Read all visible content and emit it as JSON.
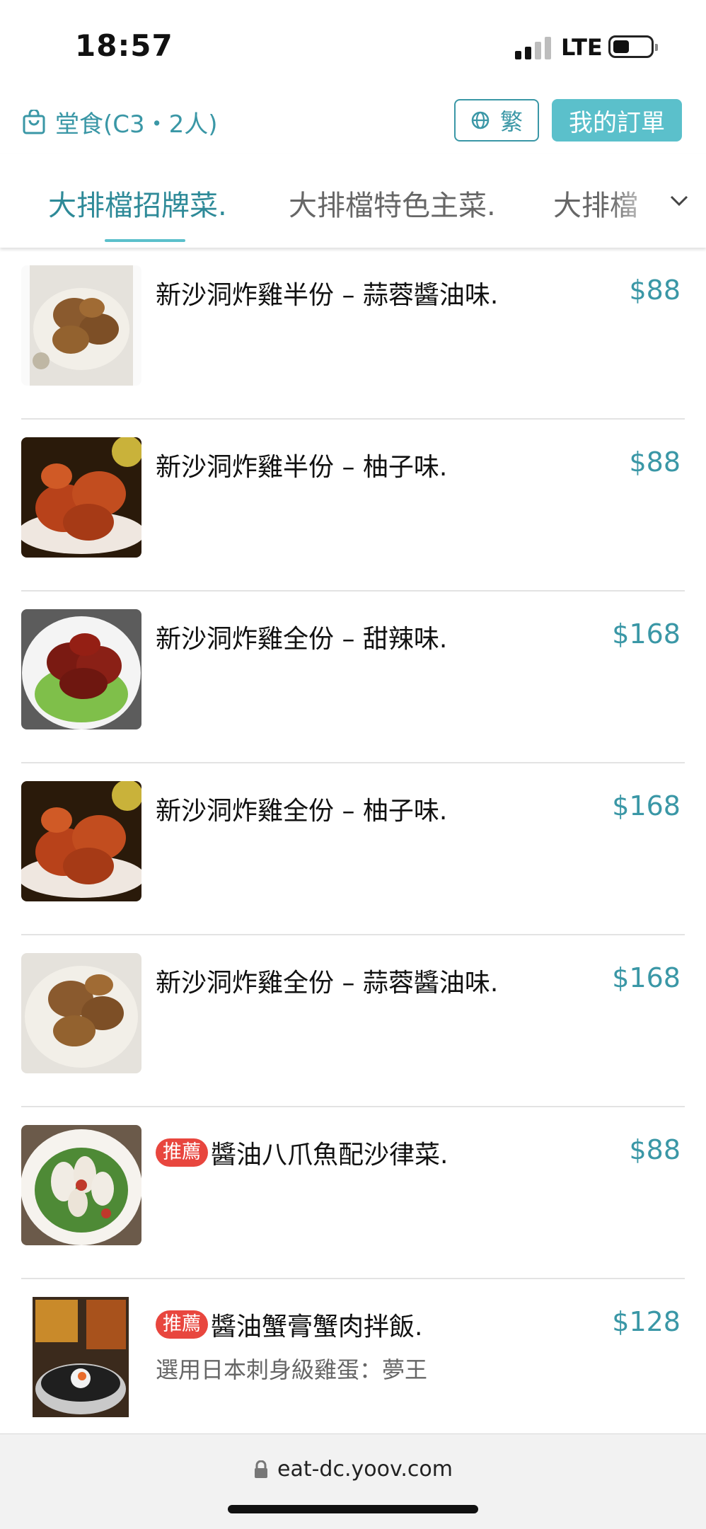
{
  "status_bar": {
    "time": "18:57",
    "network": "LTE"
  },
  "header": {
    "dine_info": "堂食(C3・2人)",
    "language_label": "繁",
    "orders_label": "我的訂單"
  },
  "tabs": [
    {
      "label": "大排檔招牌菜."
    },
    {
      "label": "大排檔特色主菜."
    },
    {
      "label": "大排檔"
    }
  ],
  "colors": {
    "accent": "#3a97a6",
    "button": "#5bc0cb",
    "tag": "#e8463e"
  },
  "menu": {
    "items": [
      {
        "name": "新沙洞炸雞半份 – 蒜蓉醬油味.",
        "price": "$88",
        "tag": "",
        "desc": ""
      },
      {
        "name": "新沙洞炸雞半份 – 柚子味.",
        "price": "$88",
        "tag": "",
        "desc": ""
      },
      {
        "name": "新沙洞炸雞全份 – 甜辣味.",
        "price": "$168",
        "tag": "",
        "desc": ""
      },
      {
        "name": "新沙洞炸雞全份 – 柚子味.",
        "price": "$168",
        "tag": "",
        "desc": ""
      },
      {
        "name": "新沙洞炸雞全份 – 蒜蓉醬油味.",
        "price": "$168",
        "tag": "",
        "desc": ""
      },
      {
        "name": "醬油八爪魚配沙律菜.",
        "price": "$88",
        "tag": "推薦",
        "desc": ""
      },
      {
        "name": "醬油蟹膏蟹肉拌飯.",
        "price": "$128",
        "tag": "推薦",
        "desc": "選用日本刺身級雞蛋：夢王"
      }
    ]
  },
  "browser": {
    "url": "eat-dc.yoov.com"
  }
}
